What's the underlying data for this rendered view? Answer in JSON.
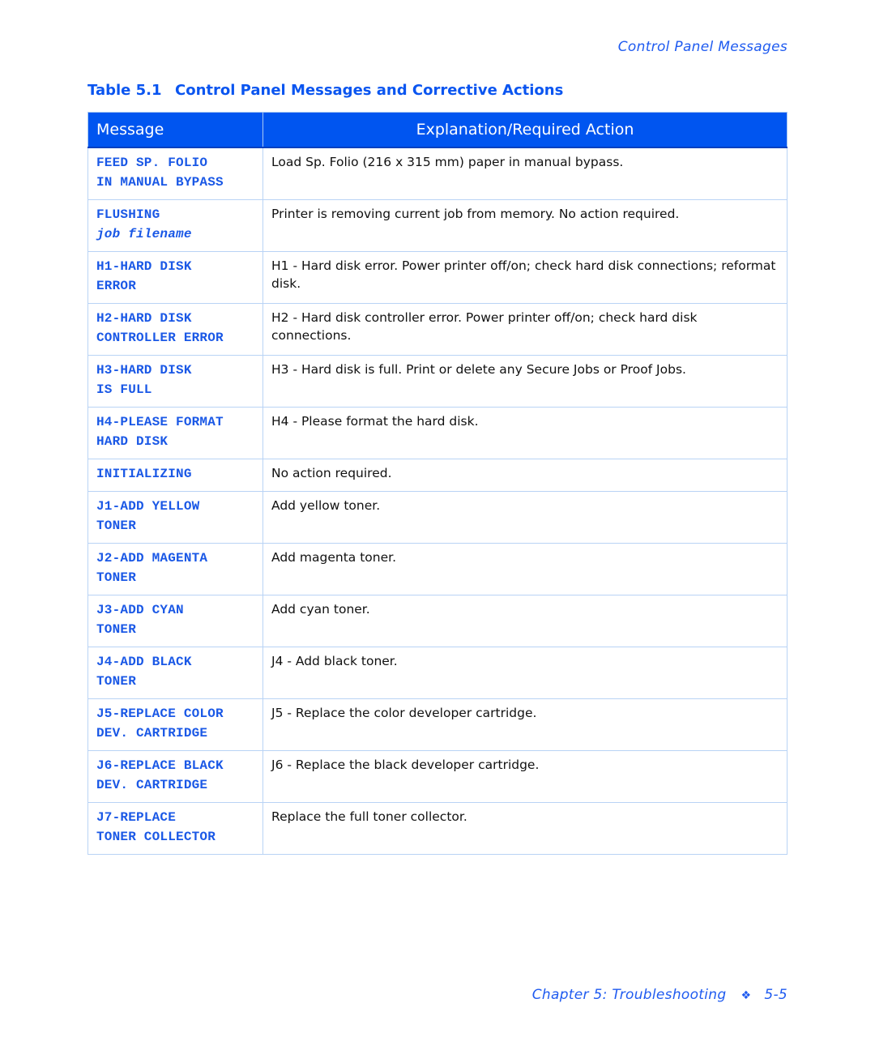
{
  "running_header": "Control Panel Messages",
  "caption": {
    "number": "Table 5.1",
    "title": "Control Panel Messages and Corrective Actions"
  },
  "table": {
    "headers": {
      "message": "Message",
      "explanation": "Explanation/Required Action"
    },
    "rows": [
      {
        "message_lines": [
          "FEED SP. FOLIO",
          "IN MANUAL BYPASS"
        ],
        "explanation": "Load Sp. Folio (216 x 315 mm) paper in manual bypass."
      },
      {
        "message_lines": [
          "FLUSHING",
          "job filename"
        ],
        "explanation": "Printer is removing current job from memory. No action required."
      },
      {
        "message_lines": [
          "H1-HARD DISK",
          "ERROR"
        ],
        "explanation": "H1 - Hard disk error. Power printer off/on; check hard disk connections; reformat disk."
      },
      {
        "message_lines": [
          "H2-HARD DISK",
          "CONTROLLER ERROR"
        ],
        "explanation": "H2 - Hard disk controller error. Power printer off/on; check hard disk connections."
      },
      {
        "message_lines": [
          "H3-HARD DISK",
          "IS FULL"
        ],
        "explanation": "H3 - Hard disk is full. Print or delete any Secure Jobs or Proof Jobs."
      },
      {
        "message_lines": [
          "H4-PLEASE FORMAT",
          "HARD DISK"
        ],
        "explanation": "H4 - Please format the hard disk."
      },
      {
        "message_lines": [
          "INITIALIZING"
        ],
        "explanation": "No action required."
      },
      {
        "message_lines": [
          "J1-ADD YELLOW",
          "TONER"
        ],
        "explanation": "Add yellow toner."
      },
      {
        "message_lines": [
          "J2-ADD MAGENTA",
          "TONER"
        ],
        "explanation": "Add magenta toner."
      },
      {
        "message_lines": [
          "J3-ADD CYAN",
          "TONER"
        ],
        "explanation": "Add cyan toner."
      },
      {
        "message_lines": [
          "J4-ADD BLACK",
          "TONER"
        ],
        "explanation": "J4 - Add black toner."
      },
      {
        "message_lines": [
          "J5-REPLACE COLOR",
          "DEV. CARTRIDGE"
        ],
        "explanation": "J5 - Replace the color developer cartridge."
      },
      {
        "message_lines": [
          "J6-REPLACE BLACK",
          "DEV. CARTRIDGE"
        ],
        "explanation": "J6 - Replace the black developer cartridge."
      },
      {
        "message_lines": [
          "J7-REPLACE",
          "TONER COLLECTOR"
        ],
        "explanation": "Replace the full toner collector."
      }
    ]
  },
  "footer": {
    "chapter": "Chapter 5: Troubleshooting",
    "separator_icon": "diamond-bullet-icon",
    "separator_glyph": "❖",
    "page": "5-5"
  },
  "colors": {
    "accent_blue": "#0055f0",
    "message_text": "#1a58e6",
    "border": "#b9d3f5"
  }
}
